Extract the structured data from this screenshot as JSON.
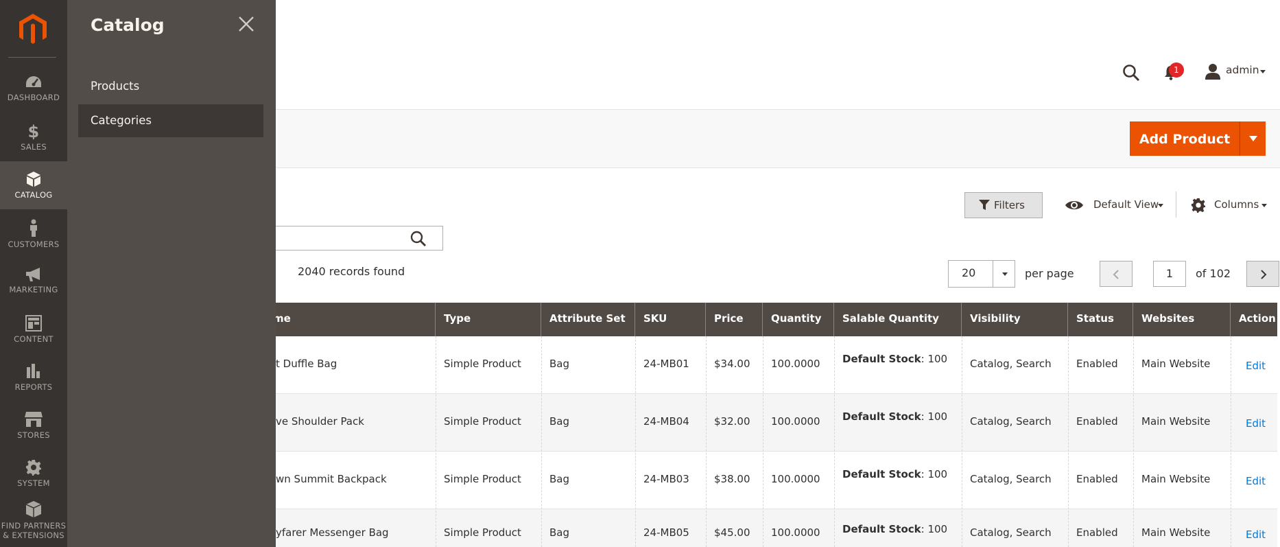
{
  "nav": {
    "items": [
      {
        "label": "DASHBOARD"
      },
      {
        "label": "SALES"
      },
      {
        "label": "CATALOG"
      },
      {
        "label": "CUSTOMERS"
      },
      {
        "label": "MARKETING"
      },
      {
        "label": "CONTENT"
      },
      {
        "label": "REPORTS"
      },
      {
        "label": "STORES"
      },
      {
        "label": "SYSTEM"
      },
      {
        "label_line1": "FIND PARTNERS",
        "label_line2": "& EXTENSIONS"
      }
    ]
  },
  "flyout": {
    "title": "Catalog",
    "items": [
      {
        "label": "Products"
      },
      {
        "label": "Categories"
      }
    ]
  },
  "header": {
    "notification_count": "1",
    "user": "admin"
  },
  "page_actions": {
    "add_product": "Add Product"
  },
  "toolbar": {
    "filters": "Filters",
    "view": "Default View",
    "columns": "Columns"
  },
  "grid": {
    "records_found": "2040 records found",
    "per_page_value": "20",
    "per_page_label": "per page",
    "page_value": "1",
    "page_of": "of 102",
    "columns": [
      "me",
      "Type",
      "Attribute Set",
      "SKU",
      "Price",
      "Quantity",
      "Salable Quantity",
      "Visibility",
      "Status",
      "Websites",
      "Action"
    ],
    "rows": [
      {
        "name": "t Duffle Bag",
        "type": "Simple Product",
        "attr": "Bag",
        "sku": "24-MB01",
        "price": "$34.00",
        "qty": "100.0000",
        "stock_label": "Default Stock",
        "stock_value": ": 100",
        "visibility": "Catalog, Search",
        "status": "Enabled",
        "website": "Main Website",
        "action": "Edit"
      },
      {
        "name": "ve Shoulder Pack",
        "type": "Simple Product",
        "attr": "Bag",
        "sku": "24-MB04",
        "price": "$32.00",
        "qty": "100.0000",
        "stock_label": "Default Stock",
        "stock_value": ": 100",
        "visibility": "Catalog, Search",
        "status": "Enabled",
        "website": "Main Website",
        "action": "Edit"
      },
      {
        "name": "wn Summit Backpack",
        "type": "Simple Product",
        "attr": "Bag",
        "sku": "24-MB03",
        "price": "$38.00",
        "qty": "100.0000",
        "stock_label": "Default Stock",
        "stock_value": ": 100",
        "visibility": "Catalog, Search",
        "status": "Enabled",
        "website": "Main Website",
        "action": "Edit"
      },
      {
        "name": "yfarer Messenger Bag",
        "type": "Simple Product",
        "attr": "Bag",
        "sku": "24-MB05",
        "price": "$45.00",
        "qty": "100.0000",
        "stock_label": "Default Stock",
        "stock_value": ": 100",
        "visibility": "Catalog, Search",
        "status": "Enabled",
        "website": "Main Website",
        "action": "Edit"
      }
    ]
  },
  "colors": {
    "nav_bg": "#373330",
    "flyout_bg": "#524d49",
    "accent": "#eb5202",
    "table_header": "#514943",
    "link": "#007bdb"
  }
}
